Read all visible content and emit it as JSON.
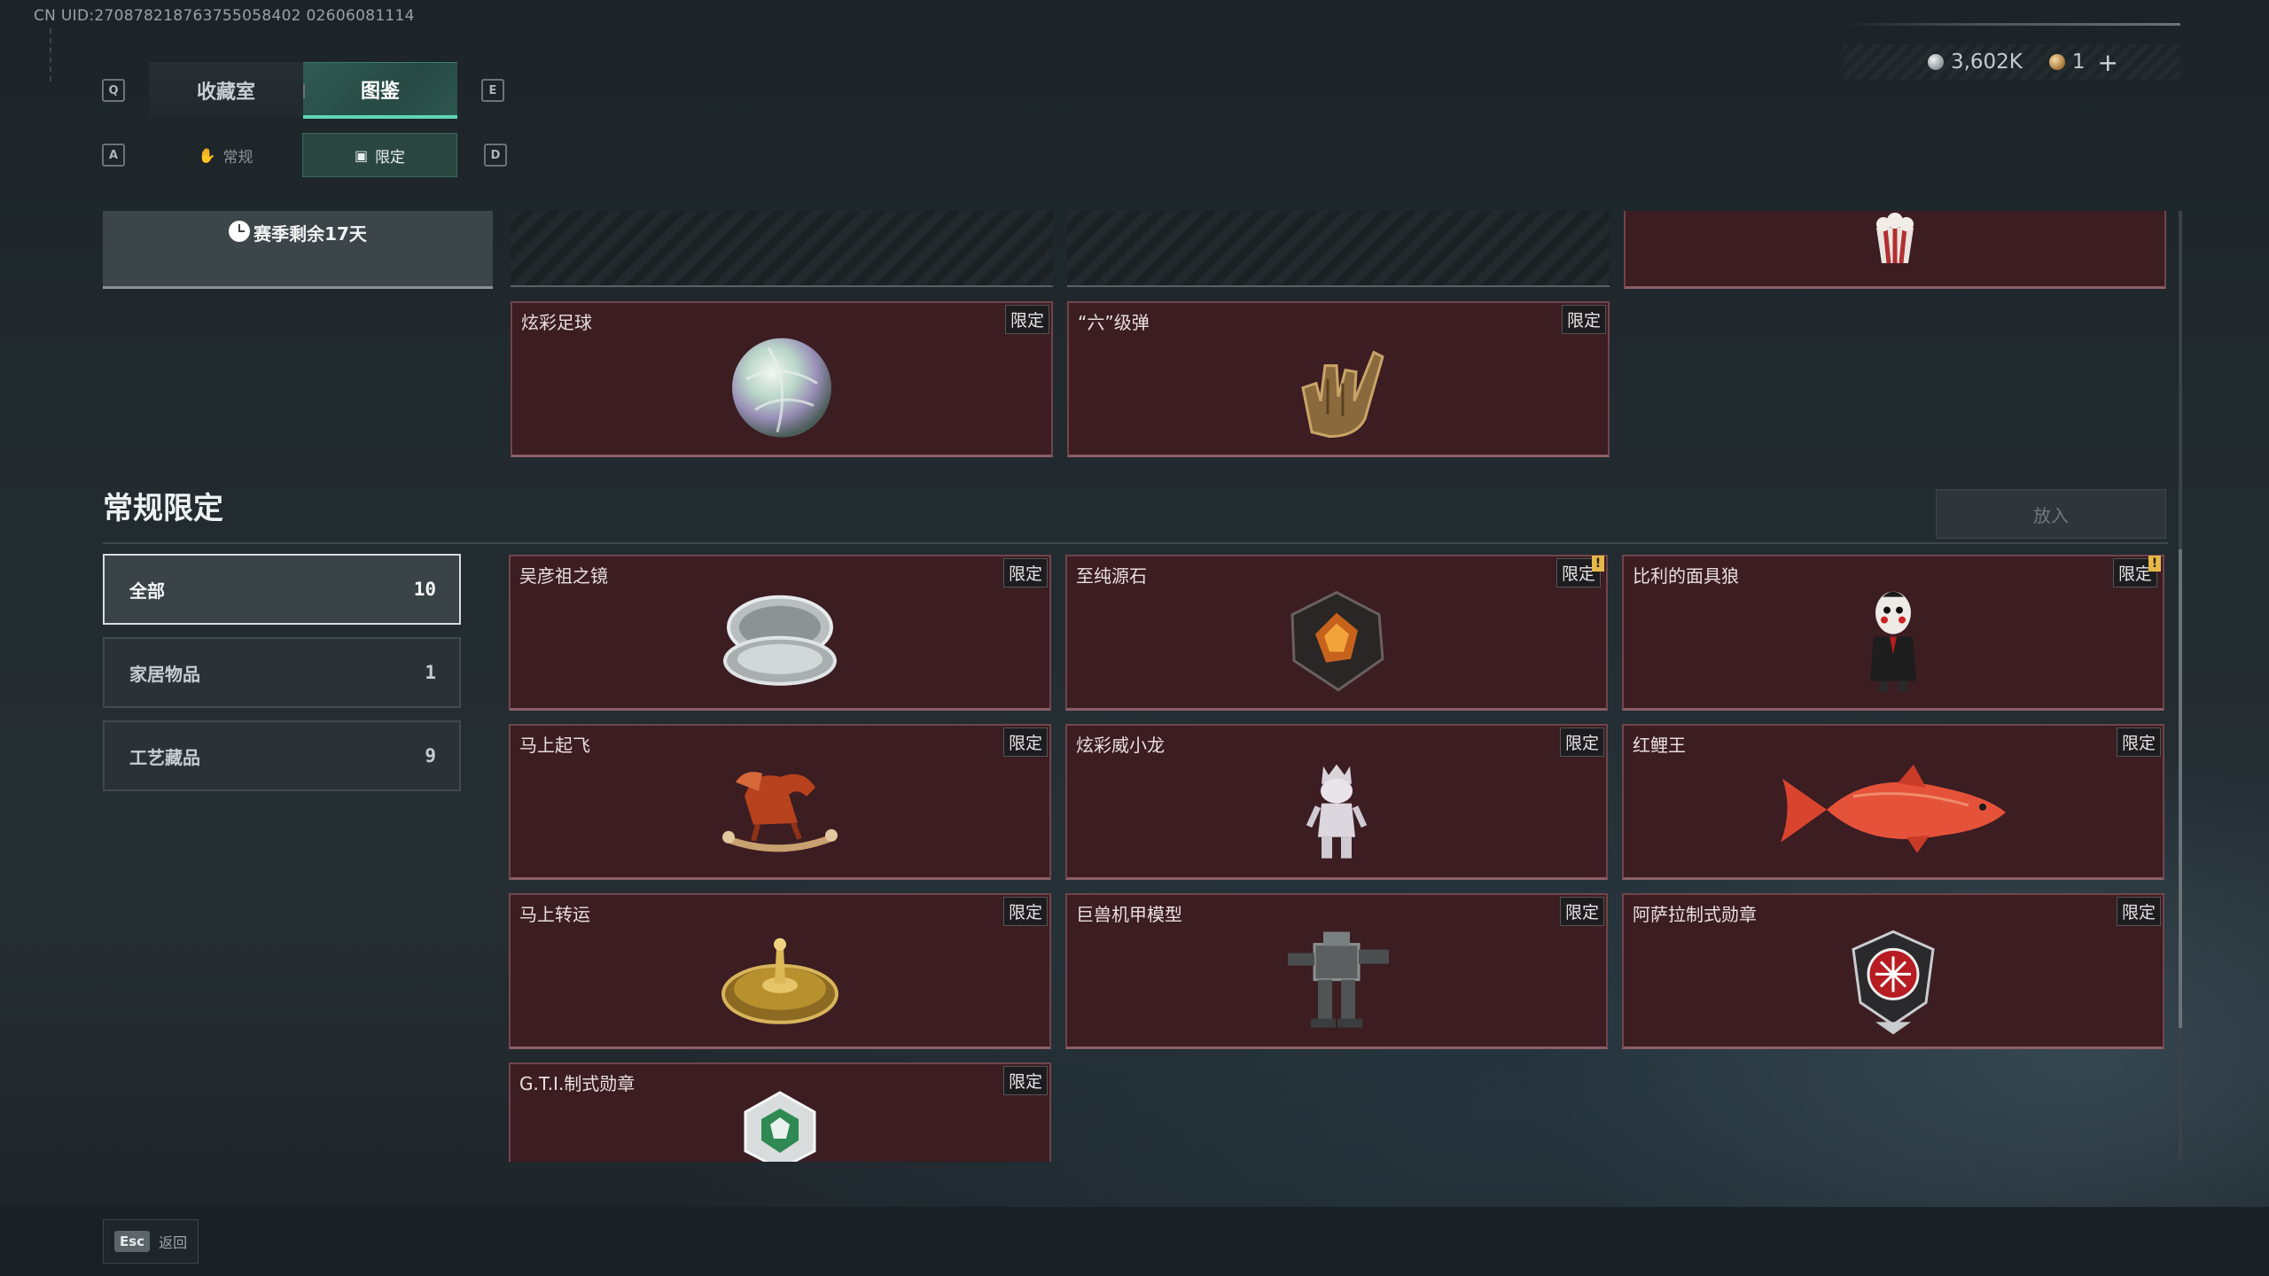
{
  "uid_text": "CN UID:270878218763755058402 02606081114",
  "keys": {
    "left_tab": "Q",
    "right_tab": "E",
    "left_sub": "A",
    "right_sub": "D"
  },
  "tabs": [
    {
      "label": "收藏室",
      "active": false
    },
    {
      "label": "图鉴",
      "active": true
    }
  ],
  "subtabs": [
    {
      "label": "常规",
      "icon": "hand-icon",
      "active": false
    },
    {
      "label": "限定",
      "icon": "image-icon",
      "active": true
    }
  ],
  "currency": {
    "silver": "3,602K",
    "gold": "1",
    "add": "+"
  },
  "season": {
    "text": "赛季剩余17天"
  },
  "top_items": [
    {
      "name": "炫彩足球",
      "tag": "限定"
    },
    {
      "name": "“六”级弹",
      "tag": "限定"
    }
  ],
  "section": {
    "title": "常规限定",
    "put_button": "放入"
  },
  "filters": [
    {
      "label": "全部",
      "count": "10",
      "active": true
    },
    {
      "label": "家居物品",
      "count": "1",
      "active": false
    },
    {
      "label": "工艺藏品",
      "count": "9",
      "active": false
    }
  ],
  "items": [
    {
      "name": "吴彦祖之镜",
      "tag": "限定",
      "alert": false
    },
    {
      "name": "至纯源石",
      "tag": "限定",
      "alert": true
    },
    {
      "name": "比利的面具狼",
      "tag": "限定",
      "alert": true
    },
    {
      "name": "马上起飞",
      "tag": "限定",
      "alert": false
    },
    {
      "name": "炫彩威小龙",
      "tag": "限定",
      "alert": false
    },
    {
      "name": "红鲤王",
      "tag": "限定",
      "alert": false
    },
    {
      "name": "马上转运",
      "tag": "限定",
      "alert": false
    },
    {
      "name": "巨兽机甲模型",
      "tag": "限定",
      "alert": false
    },
    {
      "name": "阿萨拉制式勋章",
      "tag": "限定",
      "alert": false
    },
    {
      "name": "G.T.I.制式勋章",
      "tag": "限定",
      "alert": false
    }
  ],
  "alert_mark": "!",
  "footer": {
    "esc_key": "Esc",
    "esc_label": "返回"
  }
}
